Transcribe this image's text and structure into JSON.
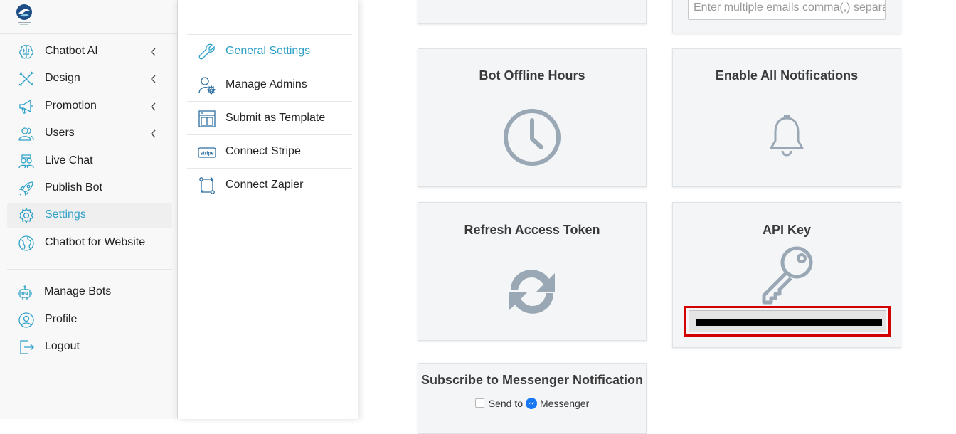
{
  "sidebar": {
    "items": [
      {
        "label": "Chatbot AI",
        "icon": "brain-icon",
        "has_chevron": true
      },
      {
        "label": "Design",
        "icon": "design-tools-icon",
        "has_chevron": true
      },
      {
        "label": "Promotion",
        "icon": "megaphone-icon",
        "has_chevron": true
      },
      {
        "label": "Users",
        "icon": "users-icon",
        "has_chevron": true
      },
      {
        "label": "Live Chat",
        "icon": "live-chat-icon",
        "has_chevron": false
      },
      {
        "label": "Publish Bot",
        "icon": "rocket-icon",
        "has_chevron": false
      },
      {
        "label": "Settings",
        "icon": "gear-icon",
        "has_chevron": false,
        "active": true
      },
      {
        "label": "Chatbot for Website",
        "icon": "globe-icon",
        "has_chevron": false
      }
    ],
    "bottom_items": [
      {
        "label": "Manage Bots",
        "icon": "robot-icon"
      },
      {
        "label": "Profile",
        "icon": "profile-icon"
      },
      {
        "label": "Logout",
        "icon": "logout-icon"
      }
    ],
    "active_color": "#2ea0c8"
  },
  "submenu": {
    "items": [
      {
        "label": "General Settings",
        "icon": "wrench-icon",
        "active": true
      },
      {
        "label": "Manage Admins",
        "icon": "admin-gear-icon"
      },
      {
        "label": "Submit as Template",
        "icon": "template-icon"
      },
      {
        "label": "Connect Stripe",
        "icon": "stripe-icon"
      },
      {
        "label": "Connect Zapier",
        "icon": "zapier-icon"
      }
    ]
  },
  "cards": {
    "email": {
      "placeholder": "Enter multiple emails comma(,) separa"
    },
    "offline_hours": {
      "title": "Bot Offline Hours",
      "icon": "clock-icon"
    },
    "notifications": {
      "title": "Enable All Notifications",
      "icon": "bell-icon"
    },
    "refresh_token": {
      "title": "Refresh Access Token",
      "icon": "refresh-icon"
    },
    "api_key": {
      "title": "API Key",
      "icon": "key-icon",
      "value_redacted": true
    },
    "messenger": {
      "title": "Subscribe to Messenger Notification",
      "send_to": "Send to",
      "messenger": "Messenger"
    }
  },
  "colors": {
    "icon_gray": "#9aa8b6",
    "highlight_red": "#d40000",
    "stripe_label": "stripe"
  }
}
